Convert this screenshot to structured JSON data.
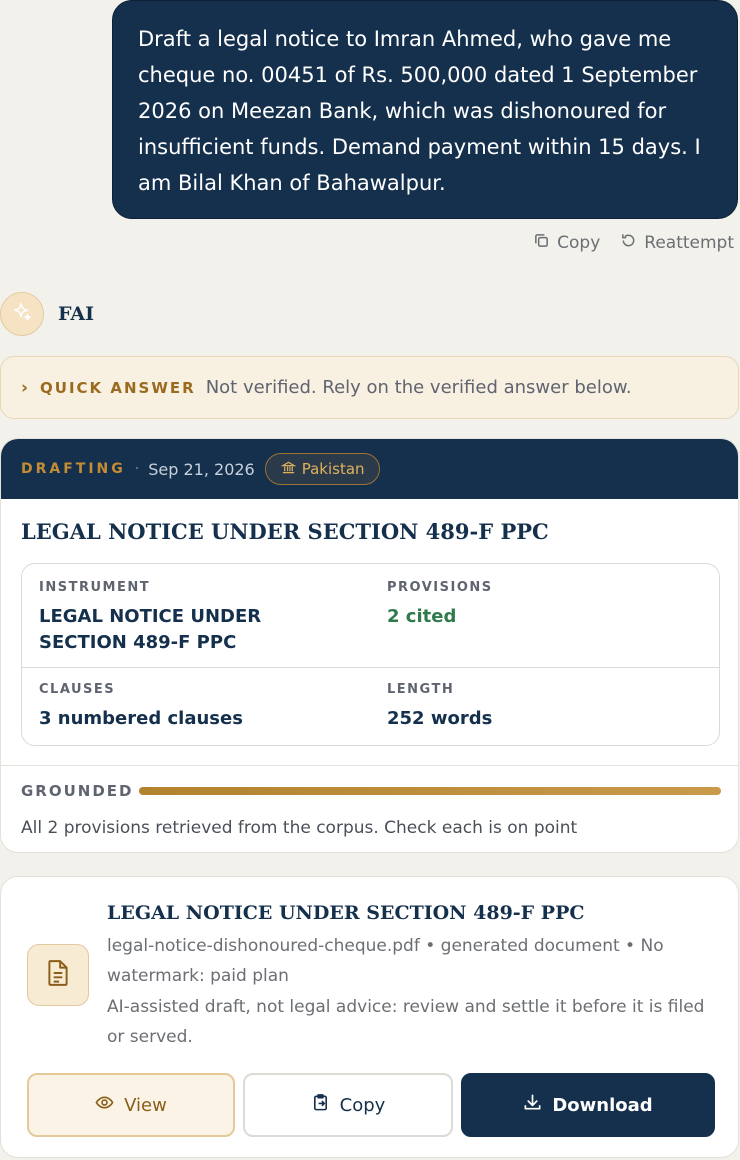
{
  "user_message": {
    "text": "Draft a legal notice to Imran Ahmed, who gave me cheque no. 00451 of Rs. 500,000 dated 1 September 2026 on Meezan Bank, which was dishonoured for insufficient funds. Demand payment within 15 days. I am Bilal Khan of Bahawalpur."
  },
  "message_actions": {
    "copy_label": "Copy",
    "reattempt_label": "Reattempt"
  },
  "assistant": {
    "name": "FAI",
    "avatar_icon": "sparkle-icon"
  },
  "quick_answer": {
    "label": "QUICK ANSWER",
    "text": "Not verified. Rely on the verified answer below."
  },
  "draft_card": {
    "mode_label": "DRAFTING",
    "date": "Sep 21, 2026",
    "jurisdiction": "Pakistan",
    "jurisdiction_icon": "bank-building-icon",
    "title": "LEGAL NOTICE UNDER SECTION 489-F PPC",
    "details": {
      "instrument_label": "INSTRUMENT",
      "instrument_value": "LEGAL NOTICE UNDER SECTION 489-F PPC",
      "provisions_label": "PROVISIONS",
      "provisions_value": "2 cited",
      "clauses_label": "CLAUSES",
      "clauses_value": "3 numbered clauses",
      "length_label": "LENGTH",
      "length_value": "252 words"
    },
    "grounded": {
      "label": "GROUNDED",
      "progress": 1.0,
      "note": "All 2 provisions retrieved from the corpus. Check each is on point"
    }
  },
  "document_card": {
    "icon": "document-icon",
    "title": "LEGAL NOTICE UNDER SECTION 489-F PPC",
    "meta": "legal-notice-dishonoured-cheque.pdf • generated document • No watermark: paid plan",
    "disclaimer": "AI-assisted draft, not legal advice: review and settle it before it is filed or served.",
    "view_label": "View",
    "copy_label": "Copy",
    "download_label": "Download"
  },
  "colors": {
    "navy": "#15304c",
    "gold": "#c48d34",
    "green": "#2f7a4a",
    "background": "#f3f1ec"
  }
}
